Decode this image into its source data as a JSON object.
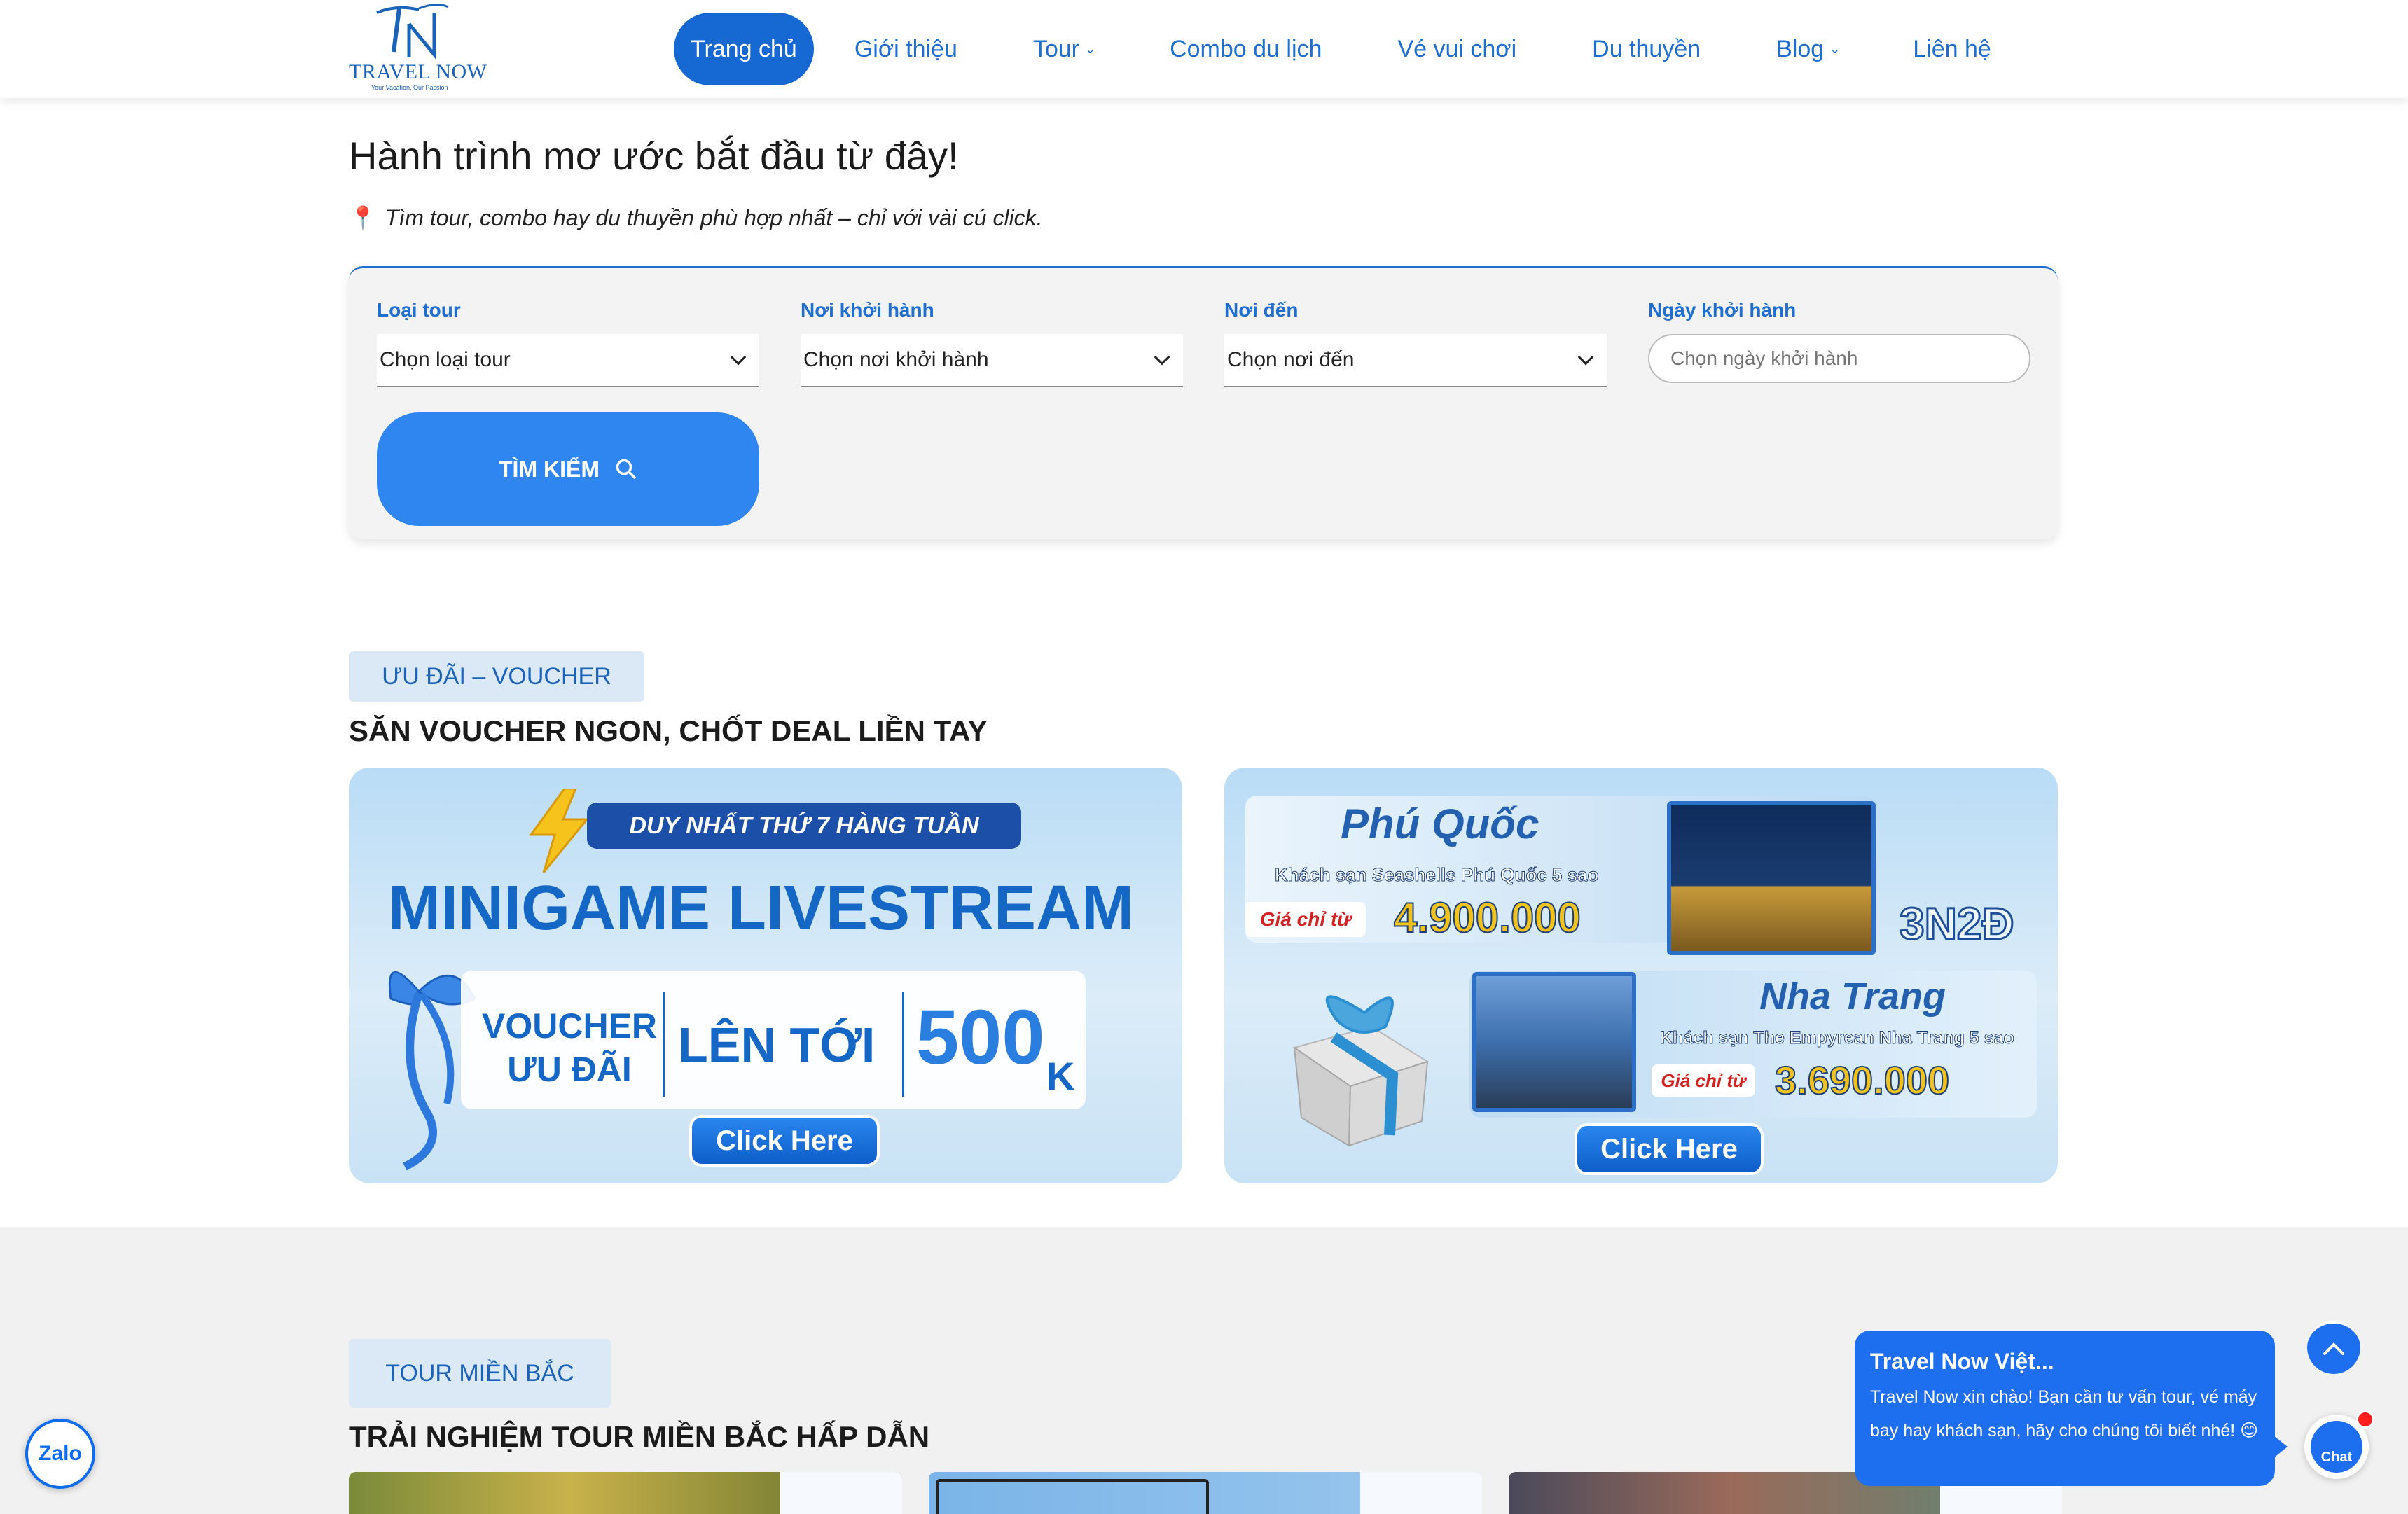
{
  "header": {
    "brand": "TRAVEL NOW",
    "slogan": "Your Vacation, Our Passion",
    "nav": [
      {
        "label": "Trang chủ",
        "active": true
      },
      {
        "label": "Giới thiệu"
      },
      {
        "label": "Tour",
        "dropdown": true
      },
      {
        "label": "Combo du lịch"
      },
      {
        "label": "Vé vui chơi"
      },
      {
        "label": "Du thuyền"
      },
      {
        "label": "Blog",
        "dropdown": true
      },
      {
        "label": "Liên hệ"
      }
    ]
  },
  "hero": {
    "title": "Hành trình mơ ước bắt đầu từ đây!",
    "subtitle": "Tìm tour, combo hay du thuyền phù hợp nhất – chỉ với vài cú click."
  },
  "search": {
    "fields": [
      {
        "label": "Loại tour",
        "value": "Chọn loại tour"
      },
      {
        "label": "Nơi khởi hành",
        "value": "Chọn nơi khởi hành"
      },
      {
        "label": "Nơi đến",
        "value": "Chọn nơi đến"
      }
    ],
    "date": {
      "label": "Ngày khởi hành",
      "placeholder": "Chọn ngày khởi hành"
    },
    "button": "TÌM KIẾM"
  },
  "voucher": {
    "badge": "ƯU ĐÃI – VOUCHER",
    "title": "SĂN VOUCHER NGON, CHỐT DEAL LIỀN TAY",
    "banner1": {
      "strip": "DUY NHẤT THỨ 7 HÀNG TUẦN",
      "headline": "MINIGAME LIVESTREAM",
      "voucher_line1": "VOUCHER",
      "voucher_line2": "ƯU ĐÃI",
      "up_to": "LÊN TỚI",
      "amount": "500",
      "unit": "K",
      "cta": "Click Here"
    },
    "banner2": {
      "dest1": "Phú Quốc",
      "hotel1": "Khách sạn Seashells Phú Quốc 5 sao",
      "price_label": "Giá chỉ từ",
      "price1": "4.900.000",
      "duration": "3N2Đ",
      "dest2": "Nha Trang",
      "hotel2": "Khách sạn The Empyrean Nha Trang 5 sao",
      "price2": "3.690.000",
      "cta": "Click Here"
    }
  },
  "north": {
    "badge": "TOUR MIỀN BẮC",
    "title": "TRẢI NGHIỆM TOUR MIỀN BẮC HẤP DẪN"
  },
  "floating": {
    "zalo": "Zalo",
    "chat_title": "Travel Now Việt...",
    "chat_message": "Travel Now xin chào! Bạn cần tư vấn tour, vé máy bay hay khách sạn, hãy cho chúng tôi biết nhé! 😊",
    "chat_icon_label": "Chat"
  },
  "colors": {
    "primary": "#1f6fd1",
    "button": "#2f86f0",
    "badge_bg": "#dbe8f5",
    "section_bg": "#f1f1f1"
  }
}
